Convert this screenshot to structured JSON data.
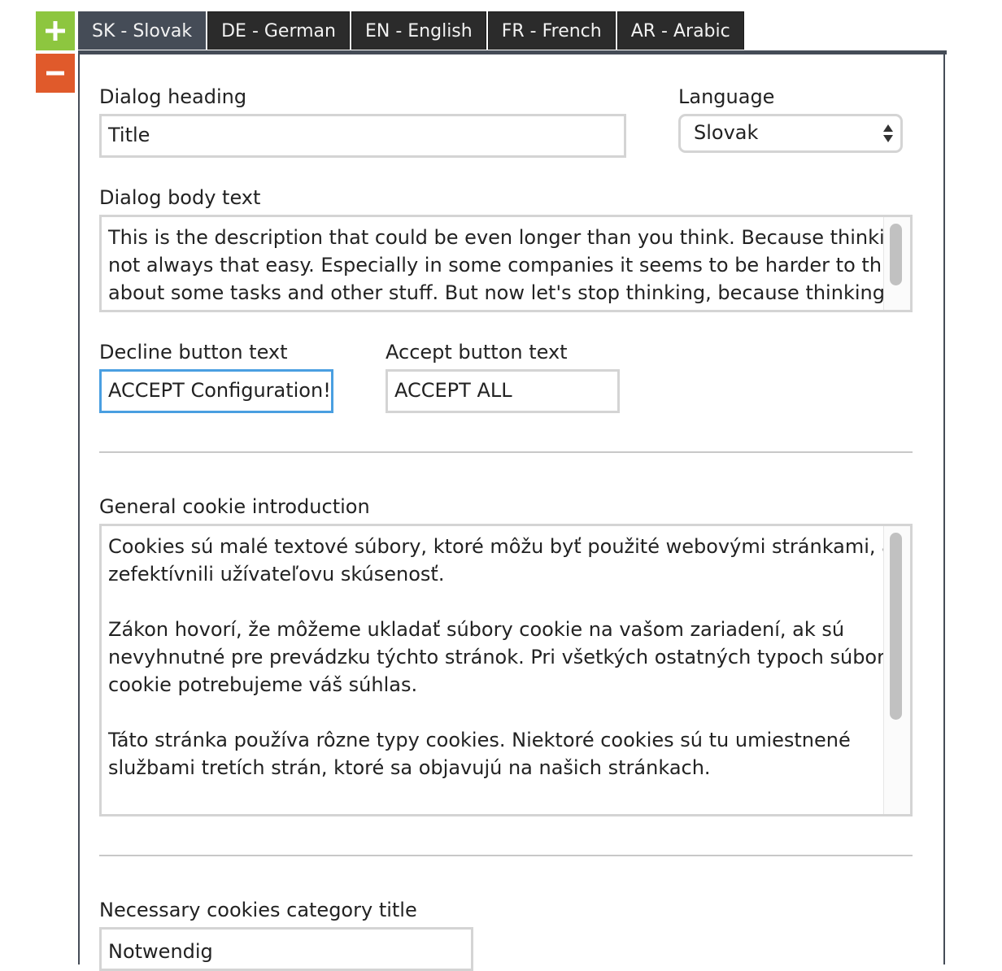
{
  "side_buttons": {
    "add_icon": "plus-icon",
    "remove_icon": "minus-icon",
    "add_color": "#8dc63f",
    "remove_color": "#e05a2b"
  },
  "tabs": [
    {
      "label": "SK - Slovak",
      "active": true
    },
    {
      "label": "DE - German",
      "active": false
    },
    {
      "label": "EN - English",
      "active": false
    },
    {
      "label": "FR - French",
      "active": false
    },
    {
      "label": "AR - Arabic",
      "active": false
    }
  ],
  "form": {
    "dialog_heading_label": "Dialog heading",
    "dialog_heading_value": "Title",
    "language_label": "Language",
    "language_value": "Slovak",
    "dialog_body_label": "Dialog body text",
    "dialog_body_lines": [
      "This is the description that could be even longer than you think. Because thinking is",
      "not always that easy. Especially in some companies it seems to be harder to think",
      "about some tasks and other stuff. But now let's stop thinking, because thinking"
    ],
    "decline_label": "Decline button text",
    "decline_value": "ACCEPT Configuration!",
    "accept_label": "Accept button text",
    "accept_value": "ACCEPT ALL",
    "cookie_intro_label": "General cookie introduction",
    "cookie_intro_lines": [
      "Cookies sú malé textové súbory, ktoré môžu byť použité webovými stránkami, aby",
      "zefektívnili užívateľovu skúsenosť.",
      "",
      "Zákon hovorí, že môžeme ukladať súbory cookie na vašom zariadení, ak sú",
      "nevyhnutné pre prevádzku týchto stránok. Pri všetkých ostatných typoch súborov",
      "cookie potrebujeme váš súhlas.",
      "",
      "Táto stránka používa rôzne typy cookies. Niektoré cookies sú tu umiestnené",
      "službami tretích strán, ktoré sa objavujú na našich stránkach."
    ],
    "necessary_title_label": "Necessary cookies category title",
    "necessary_title_value": "Notwendig"
  },
  "colors": {
    "tab_bg": "#2b2b2b",
    "tab_active_bg": "#454c57",
    "focus_border": "#4a9fe1"
  }
}
